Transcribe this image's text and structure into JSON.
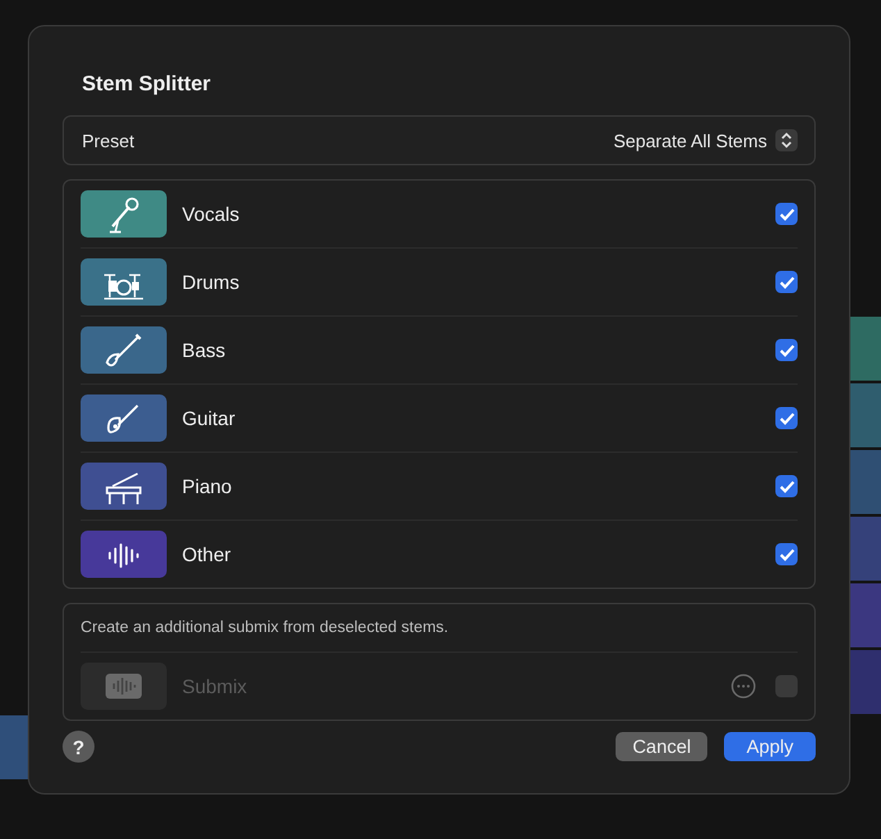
{
  "dialog": {
    "title": "Stem Splitter"
  },
  "preset": {
    "label": "Preset",
    "value": "Separate All Stems"
  },
  "stems": [
    {
      "name": "Vocals",
      "color": "#3f8a85",
      "checked": true
    },
    {
      "name": "Drums",
      "color": "#3a7189",
      "checked": true
    },
    {
      "name": "Bass",
      "color": "#3a678b",
      "checked": true
    },
    {
      "name": "Guitar",
      "color": "#3c5d90",
      "checked": true
    },
    {
      "name": "Piano",
      "color": "#3f4f92",
      "checked": true
    },
    {
      "name": "Other",
      "color": "#47399a",
      "checked": true
    }
  ],
  "submix": {
    "description": "Create an additional submix from deselected stems.",
    "name": "Submix",
    "disabled": true,
    "checked": false
  },
  "help": {
    "label": "?"
  },
  "buttons": [
    {
      "label": "Cancel",
      "kind": "secondary"
    },
    {
      "label": "Apply",
      "kind": "primary"
    }
  ]
}
